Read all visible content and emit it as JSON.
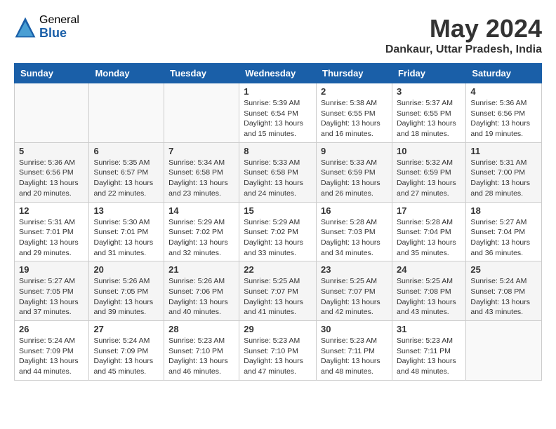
{
  "logo": {
    "general": "General",
    "blue": "Blue"
  },
  "title": "May 2024",
  "location": "Dankaur, Uttar Pradesh, India",
  "headers": [
    "Sunday",
    "Monday",
    "Tuesday",
    "Wednesday",
    "Thursday",
    "Friday",
    "Saturday"
  ],
  "weeks": [
    [
      {
        "day": "",
        "info": ""
      },
      {
        "day": "",
        "info": ""
      },
      {
        "day": "",
        "info": ""
      },
      {
        "day": "1",
        "info": "Sunrise: 5:39 AM\nSunset: 6:54 PM\nDaylight: 13 hours\nand 15 minutes."
      },
      {
        "day": "2",
        "info": "Sunrise: 5:38 AM\nSunset: 6:55 PM\nDaylight: 13 hours\nand 16 minutes."
      },
      {
        "day": "3",
        "info": "Sunrise: 5:37 AM\nSunset: 6:55 PM\nDaylight: 13 hours\nand 18 minutes."
      },
      {
        "day": "4",
        "info": "Sunrise: 5:36 AM\nSunset: 6:56 PM\nDaylight: 13 hours\nand 19 minutes."
      }
    ],
    [
      {
        "day": "5",
        "info": "Sunrise: 5:36 AM\nSunset: 6:56 PM\nDaylight: 13 hours\nand 20 minutes."
      },
      {
        "day": "6",
        "info": "Sunrise: 5:35 AM\nSunset: 6:57 PM\nDaylight: 13 hours\nand 22 minutes."
      },
      {
        "day": "7",
        "info": "Sunrise: 5:34 AM\nSunset: 6:58 PM\nDaylight: 13 hours\nand 23 minutes."
      },
      {
        "day": "8",
        "info": "Sunrise: 5:33 AM\nSunset: 6:58 PM\nDaylight: 13 hours\nand 24 minutes."
      },
      {
        "day": "9",
        "info": "Sunrise: 5:33 AM\nSunset: 6:59 PM\nDaylight: 13 hours\nand 26 minutes."
      },
      {
        "day": "10",
        "info": "Sunrise: 5:32 AM\nSunset: 6:59 PM\nDaylight: 13 hours\nand 27 minutes."
      },
      {
        "day": "11",
        "info": "Sunrise: 5:31 AM\nSunset: 7:00 PM\nDaylight: 13 hours\nand 28 minutes."
      }
    ],
    [
      {
        "day": "12",
        "info": "Sunrise: 5:31 AM\nSunset: 7:01 PM\nDaylight: 13 hours\nand 29 minutes."
      },
      {
        "day": "13",
        "info": "Sunrise: 5:30 AM\nSunset: 7:01 PM\nDaylight: 13 hours\nand 31 minutes."
      },
      {
        "day": "14",
        "info": "Sunrise: 5:29 AM\nSunset: 7:02 PM\nDaylight: 13 hours\nand 32 minutes."
      },
      {
        "day": "15",
        "info": "Sunrise: 5:29 AM\nSunset: 7:02 PM\nDaylight: 13 hours\nand 33 minutes."
      },
      {
        "day": "16",
        "info": "Sunrise: 5:28 AM\nSunset: 7:03 PM\nDaylight: 13 hours\nand 34 minutes."
      },
      {
        "day": "17",
        "info": "Sunrise: 5:28 AM\nSunset: 7:04 PM\nDaylight: 13 hours\nand 35 minutes."
      },
      {
        "day": "18",
        "info": "Sunrise: 5:27 AM\nSunset: 7:04 PM\nDaylight: 13 hours\nand 36 minutes."
      }
    ],
    [
      {
        "day": "19",
        "info": "Sunrise: 5:27 AM\nSunset: 7:05 PM\nDaylight: 13 hours\nand 37 minutes."
      },
      {
        "day": "20",
        "info": "Sunrise: 5:26 AM\nSunset: 7:05 PM\nDaylight: 13 hours\nand 39 minutes."
      },
      {
        "day": "21",
        "info": "Sunrise: 5:26 AM\nSunset: 7:06 PM\nDaylight: 13 hours\nand 40 minutes."
      },
      {
        "day": "22",
        "info": "Sunrise: 5:25 AM\nSunset: 7:07 PM\nDaylight: 13 hours\nand 41 minutes."
      },
      {
        "day": "23",
        "info": "Sunrise: 5:25 AM\nSunset: 7:07 PM\nDaylight: 13 hours\nand 42 minutes."
      },
      {
        "day": "24",
        "info": "Sunrise: 5:25 AM\nSunset: 7:08 PM\nDaylight: 13 hours\nand 43 minutes."
      },
      {
        "day": "25",
        "info": "Sunrise: 5:24 AM\nSunset: 7:08 PM\nDaylight: 13 hours\nand 43 minutes."
      }
    ],
    [
      {
        "day": "26",
        "info": "Sunrise: 5:24 AM\nSunset: 7:09 PM\nDaylight: 13 hours\nand 44 minutes."
      },
      {
        "day": "27",
        "info": "Sunrise: 5:24 AM\nSunset: 7:09 PM\nDaylight: 13 hours\nand 45 minutes."
      },
      {
        "day": "28",
        "info": "Sunrise: 5:23 AM\nSunset: 7:10 PM\nDaylight: 13 hours\nand 46 minutes."
      },
      {
        "day": "29",
        "info": "Sunrise: 5:23 AM\nSunset: 7:10 PM\nDaylight: 13 hours\nand 47 minutes."
      },
      {
        "day": "30",
        "info": "Sunrise: 5:23 AM\nSunset: 7:11 PM\nDaylight: 13 hours\nand 48 minutes."
      },
      {
        "day": "31",
        "info": "Sunrise: 5:23 AM\nSunset: 7:11 PM\nDaylight: 13 hours\nand 48 minutes."
      },
      {
        "day": "",
        "info": ""
      }
    ]
  ]
}
